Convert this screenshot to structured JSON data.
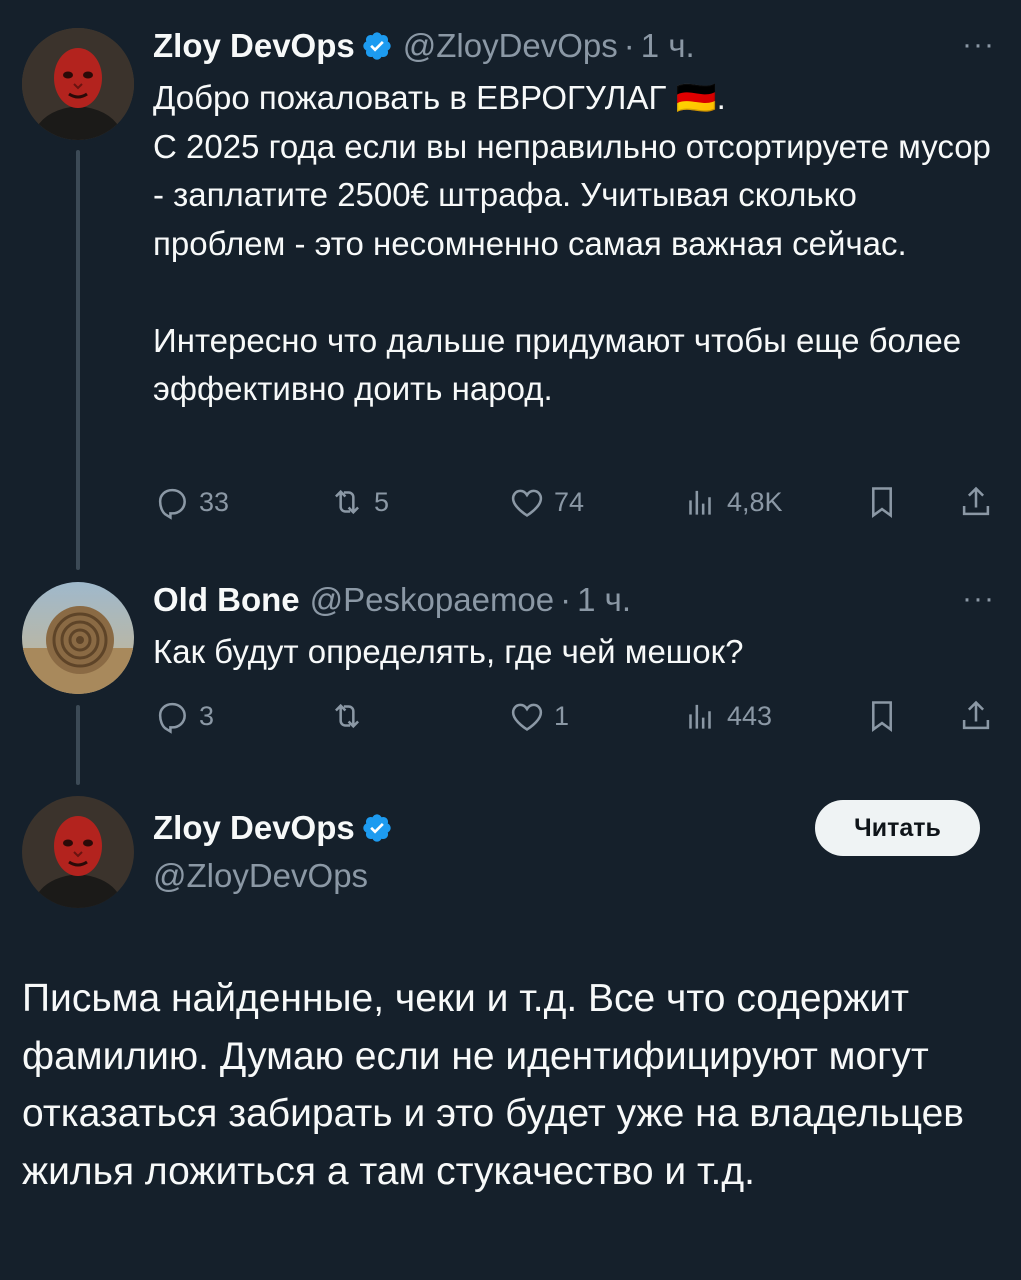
{
  "tweet1": {
    "name": "Zloy DevOps",
    "handle": "@ZloyDevOps",
    "dot": "·",
    "time": "1 ч.",
    "more": "···",
    "text": "Добро пожаловать в ЕВРОГУЛАГ 🇩🇪.\nС 2025 года если вы неправильно отсортируете мусор - заплатите 2500€ штрафа. Учитывая сколько проблем - это несомненно самая важная сейчас.\n\nИнтересно что дальше придумают чтобы еще более эффективно доить народ.",
    "replies": "33",
    "reposts": "5",
    "likes": "74",
    "views": "4,8K"
  },
  "tweet2": {
    "name": "Old Bone",
    "handle": "@Peskopaemoe",
    "dot": "·",
    "time": "1 ч.",
    "more": "···",
    "text": "Как будут определять, где чей мешок?",
    "replies": "3",
    "reposts": "",
    "likes": "1",
    "views": "443"
  },
  "main": {
    "name": "Zloy DevOps",
    "handle": "@ZloyDevOps",
    "follow_label": "Читать",
    "text": "Письма найденные, чеки и т.д. Все что содержит фамилию. Думаю если не идентифицируют могут отказаться забирать и это будет уже на владельцев жилья ложиться а там стукачество и т.д."
  },
  "colors": {
    "background": "#15202b",
    "text": "#f7f9f9",
    "muted": "#8b98a5",
    "verified": "#1d9bf0"
  },
  "icons": [
    "reply-icon",
    "repost-icon",
    "like-icon",
    "views-icon",
    "bookmark-icon",
    "share-icon",
    "verified-icon"
  ]
}
